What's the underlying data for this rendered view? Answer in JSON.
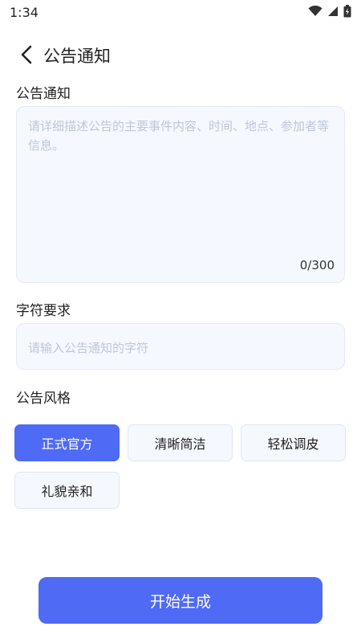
{
  "status_bar": {
    "time": "1:34"
  },
  "header": {
    "title": "公告通知"
  },
  "notice": {
    "label": "公告通知",
    "placeholder": "请详细描述公告的主要事件内容、时间、地点、参加者等信息。",
    "value": "",
    "counter": "0/300"
  },
  "chars": {
    "label": "字符要求",
    "placeholder": "请输入公告通知的字符",
    "value": ""
  },
  "style": {
    "label": "公告风格",
    "options": [
      {
        "label": "正式官方",
        "selected": true
      },
      {
        "label": "清晰简洁",
        "selected": false
      },
      {
        "label": "轻松调皮",
        "selected": false
      },
      {
        "label": "礼貌亲和",
        "selected": false
      }
    ]
  },
  "generate_button": {
    "label": "开始生成"
  },
  "colors": {
    "accent": "#4f6af5",
    "field_bg": "#f5f8ff",
    "placeholder": "#bfc6d8"
  }
}
